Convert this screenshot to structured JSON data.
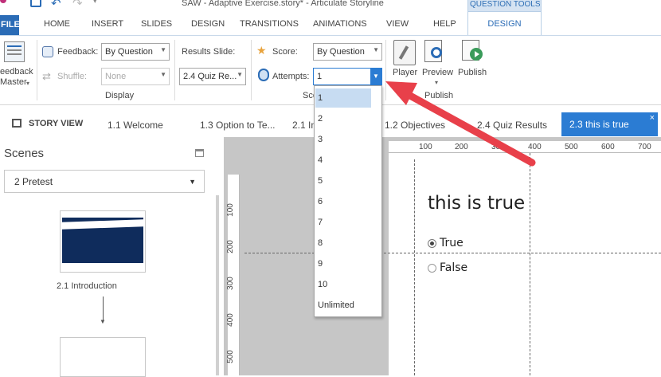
{
  "titlebar": {
    "title": "SAW - Adaptive Exercise.story* - Articulate Storyline",
    "question_tools": "QUESTION TOOLS"
  },
  "ribbon_tabs": [
    "HOME",
    "INSERT",
    "SLIDES",
    "DESIGN",
    "TRANSITIONS",
    "ANIMATIONS",
    "VIEW",
    "HELP"
  ],
  "file_tab": "FILE",
  "design_tab": "DESIGN",
  "ribbon": {
    "feedback_master": "eedback\nMaster",
    "feedback_label": "Feedback:",
    "feedback_value": "By Question",
    "shuffle_label": "Shuffle:",
    "shuffle_value": "None",
    "display_group": "Display",
    "results_slide_label": "Results Slide:",
    "results_slide_value": "2.4 Quiz Re...",
    "score_label": "Score:",
    "score_value": "By Question",
    "attempts_label": "Attempts:",
    "attempts_value": "1",
    "scoring_group": "Sco",
    "player_label": "Player",
    "preview_label": "Preview",
    "publish_label": "Publish",
    "publish_group": "Publish"
  },
  "story_tabs": {
    "story_view": "STORY VIEW",
    "tabs": [
      "1.1 Welcome",
      "1.3 Option to Te...",
      "2.1 In",
      "1.2 Objectives",
      "2.4 Quiz Results"
    ],
    "active": "2.3 this is true"
  },
  "scenes_panel": {
    "title": "Scenes",
    "scene_select": "2 Pretest",
    "thumb_label": "2.1 Introduction"
  },
  "dropdown": {
    "items": [
      "1",
      "2",
      "3",
      "4",
      "5",
      "6",
      "7",
      "8",
      "9",
      "10",
      "Unlimited"
    ],
    "selected": "1"
  },
  "ruler": {
    "top": [
      "100",
      "200",
      "300",
      "400",
      "500",
      "600",
      "700"
    ],
    "left": [
      "100",
      "200",
      "300",
      "400",
      "500"
    ]
  },
  "slide": {
    "question": "this is true",
    "options": [
      "True",
      "False"
    ],
    "selected_option": "True"
  },
  "colors": {
    "accent": "#2b7cd3",
    "file_tab": "#2b6cb6",
    "arrow": "#e8404a",
    "navy": "#0f2c5c"
  }
}
